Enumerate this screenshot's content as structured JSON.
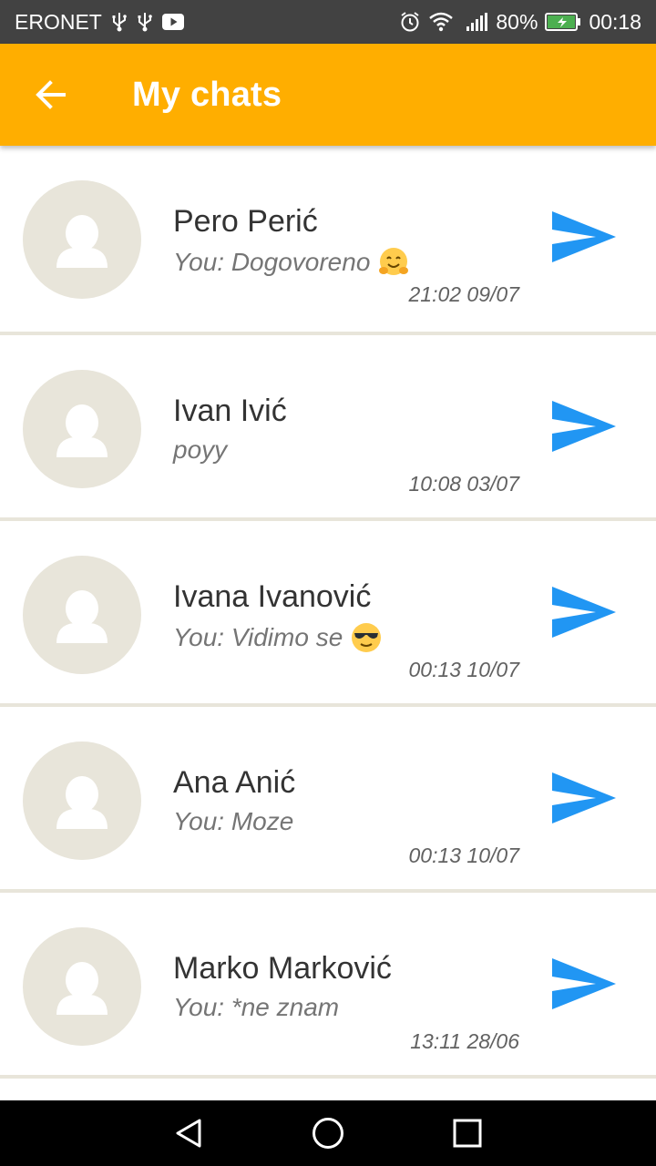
{
  "status_bar": {
    "carrier": "ERONET",
    "battery": "80%",
    "time": "00:18"
  },
  "app_bar": {
    "title": "My chats"
  },
  "colors": {
    "accent": "#FFAE00",
    "send": "#2196F3",
    "avatar_bg": "#E8E5DA"
  },
  "chats": [
    {
      "name": "Pero Perić",
      "last_message": "You: Dogovoreno",
      "emoji": "hugging-face-emoji",
      "time": "21:02 09/07"
    },
    {
      "name": "Ivan Ivić",
      "last_message": "poyy",
      "emoji": "",
      "time": "10:08 03/07"
    },
    {
      "name": "Ivana Ivanović",
      "last_message": "You: Vidimo se",
      "emoji": "sunglasses-emoji",
      "time": "00:13 10/07"
    },
    {
      "name": "Ana Anić",
      "last_message": "You: Moze",
      "emoji": "",
      "time": "00:13 10/07"
    },
    {
      "name": "Marko Marković",
      "last_message": "You: *ne znam",
      "emoji": "",
      "time": "13:11 28/06"
    }
  ]
}
